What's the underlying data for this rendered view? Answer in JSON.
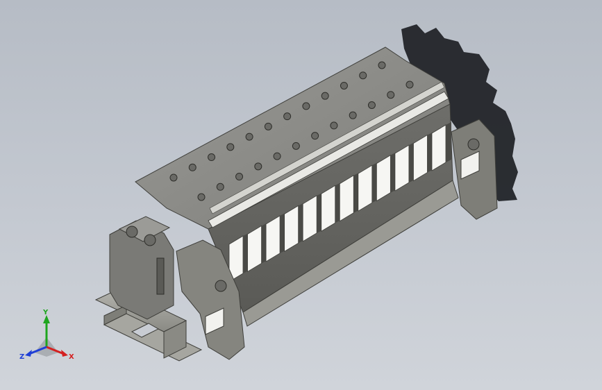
{
  "viewport": {
    "background_top": "#b6bcc5",
    "background_bottom": "#d0d4da",
    "model": {
      "name": "terminal-block-assembly",
      "terminal_count": 12,
      "part_color": "#8a8a86",
      "part_dark": "#4d4d4a",
      "shadow_color": "#1d2024",
      "rail_color": "#9c9c96"
    }
  },
  "triad": {
    "x_label": "X",
    "y_label": "Y",
    "z_label": "Z",
    "x_color": "#d42020",
    "y_color": "#1ea51e",
    "z_color": "#1f3fd6"
  }
}
